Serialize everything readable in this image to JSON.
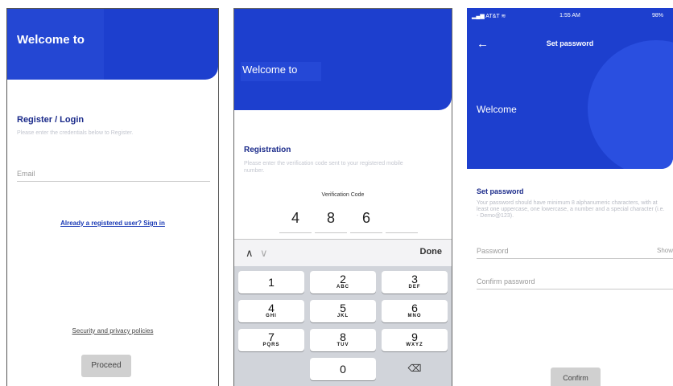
{
  "screen1": {
    "header_title": "Welcome to",
    "heading": "Register / Login",
    "instruction": "Please enter the credentials below to Register.",
    "email_label": "Email",
    "signin_link": "Already a registered user? Sign in",
    "security_link": "Security and privacy policies",
    "proceed_label": "Proceed"
  },
  "screen2": {
    "header_title": "Welcome to",
    "heading": "Registration",
    "instruction": "Please enter the verification code sent to your registered mobile number.",
    "code_label": "Verification Code",
    "code_digits": [
      "4",
      "8",
      "6",
      ""
    ],
    "keypad": {
      "up": "∧",
      "down": "∨",
      "done_label": "Done",
      "keys": [
        {
          "num": "1",
          "letters": ""
        },
        {
          "num": "2",
          "letters": "ABC"
        },
        {
          "num": "3",
          "letters": "DEF"
        },
        {
          "num": "4",
          "letters": "GHI"
        },
        {
          "num": "5",
          "letters": "JKL"
        },
        {
          "num": "6",
          "letters": "MNO"
        },
        {
          "num": "7",
          "letters": "PQRS"
        },
        {
          "num": "8",
          "letters": "TUV"
        },
        {
          "num": "9",
          "letters": "WXYZ"
        },
        {
          "num": "0",
          "letters": ""
        }
      ],
      "backspace_glyph": "⌫"
    }
  },
  "screen3": {
    "status": {
      "carrier": "AT&T",
      "time": "1:55 AM",
      "battery": "98%"
    },
    "back_glyph": "←",
    "title": "Set password",
    "welcome": "Welcome",
    "heading": "Set password",
    "description": "Your password should have minimum 8 alphanumeric characters, with at least one uppercase, one lowercase, a number and a special character (i.e. - Demo@123).",
    "password_label": "Password",
    "show_label": "Show",
    "confirm_password_label": "Confirm password",
    "confirm_label": "Confirm"
  },
  "colors": {
    "brand_blue": "#1d3fce",
    "heading_navy": "#1a2a8a",
    "button_gray": "#d0d0d0"
  }
}
